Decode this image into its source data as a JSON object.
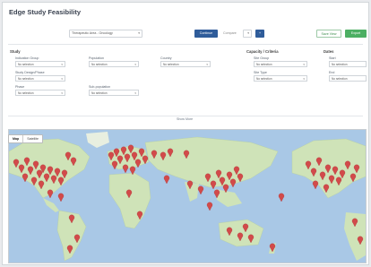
{
  "app": {
    "title": "Edge Study Feasibility"
  },
  "toolbar": {
    "selector_value": "Therapeutic Area - Oncology",
    "primary_button": "Continue",
    "secondary_label": "Compare",
    "icon_button": "+",
    "save_label": "Save View",
    "run_label": "Export"
  },
  "filters": {
    "section_study": "Study",
    "section_capacity": "Capacity / Criteria",
    "section_dates": "Dates",
    "fields": [
      {
        "label": "Indication Group",
        "value": "No selection"
      },
      {
        "label": "Study Design/Phase",
        "value": "No selection"
      },
      {
        "label": "Phase",
        "value": "No selection"
      },
      {
        "label": "Population",
        "value": "No selection"
      },
      {
        "label": "Sub-population",
        "value": "No selection"
      },
      {
        "label": "Country",
        "value": "No selection"
      },
      {
        "label": "Site Group",
        "value": "No selection"
      },
      {
        "label": "Site Type",
        "value": "No selection"
      },
      {
        "label": "Start",
        "value": "No selection"
      },
      {
        "label": "End",
        "value": "No selection"
      }
    ],
    "show_more": "Show More"
  },
  "map": {
    "tabs": [
      "Map",
      "Satellite"
    ],
    "colors": {
      "ocean": "#a9c8e6",
      "land": "#cfe3b8",
      "pin": "#d24a4a"
    }
  }
}
